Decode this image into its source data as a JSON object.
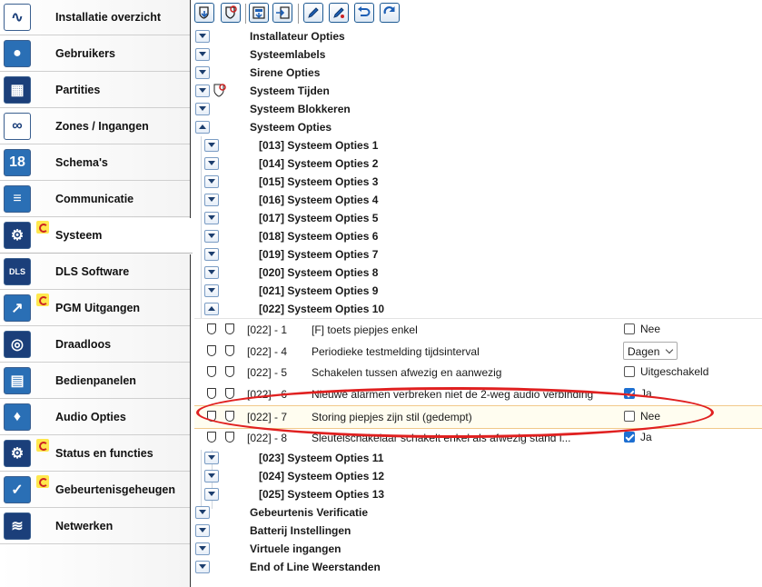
{
  "sidebar": {
    "items": [
      {
        "label": "Installatie overzicht",
        "icon": "pulse-icon",
        "badge": false,
        "active": false,
        "color": "#ffffff"
      },
      {
        "label": "Gebruikers",
        "icon": "users-icon",
        "badge": false,
        "active": false,
        "color": "#2a6fb5"
      },
      {
        "label": "Partities",
        "icon": "partitions-icon",
        "badge": false,
        "active": false,
        "color": "#1b3f7a"
      },
      {
        "label": "Zones / Ingangen",
        "icon": "zones-icon",
        "badge": false,
        "active": false,
        "color": "#ffffff"
      },
      {
        "label": "Schema's",
        "icon": "calendar-icon",
        "badge": false,
        "active": false,
        "color": "#2a6fb5"
      },
      {
        "label": "Communicatie",
        "icon": "chat-icon",
        "badge": false,
        "active": false,
        "color": "#2a6fb5"
      },
      {
        "label": "Systeem",
        "icon": "gears-icon",
        "badge": true,
        "active": true,
        "color": "#1b3f7a"
      },
      {
        "label": "DLS Software",
        "icon": "dls-icon",
        "badge": false,
        "active": false,
        "color": "#1b3f7a"
      },
      {
        "label": "PGM Uitgangen",
        "icon": "output-icon",
        "badge": true,
        "active": false,
        "color": "#2a6fb5"
      },
      {
        "label": "Draadloos",
        "icon": "wireless-icon",
        "badge": false,
        "active": false,
        "color": "#1b3f7a"
      },
      {
        "label": "Bedienpanelen",
        "icon": "keypad-icon",
        "badge": false,
        "active": false,
        "color": "#2a6fb5"
      },
      {
        "label": "Audio Opties",
        "icon": "microphone-icon",
        "badge": false,
        "active": false,
        "color": "#2a6fb5"
      },
      {
        "label": "Status en functies",
        "icon": "gears-icon",
        "badge": true,
        "active": false,
        "color": "#1b3f7a"
      },
      {
        "label": "Gebeurtenisgeheugen",
        "icon": "log-icon",
        "badge": true,
        "active": false,
        "color": "#2a6fb5"
      },
      {
        "label": "Netwerken",
        "icon": "wifi-icon",
        "badge": false,
        "active": false,
        "color": "#1b3f7a"
      }
    ]
  },
  "toolbar": {
    "buttons": [
      "shield-down-icon",
      "shield-refresh-icon",
      "download-icon",
      "upload-icon",
      "pen-icon",
      "pen-edit-icon",
      "undo-icon",
      "refresh-icon"
    ]
  },
  "tree": {
    "top_sections": [
      {
        "label": "Installateur Opties",
        "expanded": false,
        "badge": false
      },
      {
        "label": "Systeemlabels",
        "expanded": false,
        "badge": false
      },
      {
        "label": "Sirene Opties",
        "expanded": false,
        "badge": false
      },
      {
        "label": "Systeem Tijden",
        "expanded": false,
        "badge": true
      },
      {
        "label": "Systeem Blokkeren",
        "expanded": false,
        "badge": false
      },
      {
        "label": "Systeem Opties",
        "expanded": true,
        "badge": false
      }
    ],
    "sub_sections": [
      {
        "label": "[013] Systeem Opties 1",
        "expanded": false
      },
      {
        "label": "[014] Systeem Opties 2",
        "expanded": false
      },
      {
        "label": "[015] Systeem Opties 3",
        "expanded": false
      },
      {
        "label": "[016] Systeem Opties 4",
        "expanded": false
      },
      {
        "label": "[017] Systeem Opties 5",
        "expanded": false
      },
      {
        "label": "[018] Systeem Opties 6",
        "expanded": false
      },
      {
        "label": "[019] Systeem Opties 7",
        "expanded": false
      },
      {
        "label": "[020] Systeem Opties 8",
        "expanded": false
      },
      {
        "label": "[021] Systeem Opties 9",
        "expanded": false
      },
      {
        "label": "[022] Systeem Opties 10",
        "expanded": true
      }
    ],
    "options": [
      {
        "code": "[022] - 1",
        "desc": "[F] toets piepjes enkel",
        "control": "checkbox",
        "checked": false,
        "value": "Nee"
      },
      {
        "code": "[022] - 4",
        "desc": "Periodieke testmelding tijdsinterval",
        "control": "select",
        "value": "Dagen"
      },
      {
        "code": "[022] - 5",
        "desc": "Schakelen tussen afwezig en aanwezig",
        "control": "checkbox",
        "checked": false,
        "value": "Uitgeschakeld"
      },
      {
        "code": "[022] - 6",
        "desc": "Nieuwe alarmen verbreken niet de 2-weg audio verbinding",
        "control": "checkbox",
        "checked": true,
        "value": "Ja"
      },
      {
        "code": "[022] - 7",
        "desc": "Storing piepjes zijn stil (gedempt)",
        "control": "checkbox",
        "checked": false,
        "value": "Nee",
        "highlighted": true
      },
      {
        "code": "[022] - 8",
        "desc": "Sleutelschakelaar schakelt enkel als afwezig stand i...",
        "control": "checkbox",
        "checked": true,
        "value": "Ja"
      }
    ],
    "sub_sections_after": [
      {
        "label": "[023] Systeem Opties 11",
        "expanded": false
      },
      {
        "label": "[024] Systeem Opties 12",
        "expanded": false
      },
      {
        "label": "[025] Systeem Opties 13",
        "expanded": false
      }
    ],
    "bottom_sections": [
      {
        "label": "Gebeurtenis Verificatie",
        "expanded": false
      },
      {
        "label": "Batterij Instellingen",
        "expanded": false
      },
      {
        "label": "Virtuele ingangen",
        "expanded": false
      },
      {
        "label": "End of Line Weerstanden",
        "expanded": false
      }
    ]
  },
  "colors": {
    "annotation": "#e02020",
    "accent": "#1d6fd1",
    "highlight_border": "#f1c98a"
  }
}
